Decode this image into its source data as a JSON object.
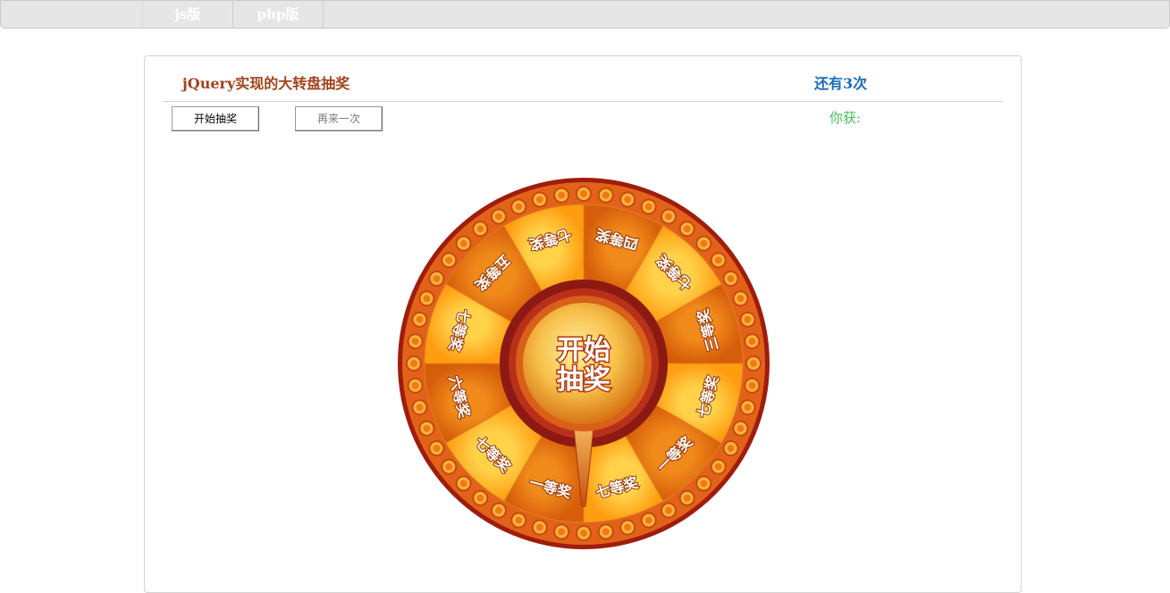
{
  "nav": {
    "tabs": [
      {
        "label": "js版"
      },
      {
        "label": "php版"
      }
    ]
  },
  "panel": {
    "title": "jQuery实现的大转盘抽奖",
    "remaining": "还有3次",
    "start_button": "开始抽奖",
    "again_button": "再来一次",
    "result_label": "你获:"
  },
  "wheel": {
    "center_text_line1": "开始",
    "center_text_line2": "抽奖",
    "prizes": [
      "四等奖",
      "七等奖",
      "三等奖",
      "七等奖",
      "一等奖",
      "七等奖",
      "一等奖",
      "七等奖",
      "六等奖",
      "七等奖",
      "五等奖",
      "七等奖"
    ],
    "colors": {
      "outer_ring": "#a0200e",
      "rim": "#e05a10",
      "segment_light": "#ffab1a",
      "segment_dark": "#e8740e",
      "hub_ring": "#8c1a12",
      "hub_button": "#f2a93b",
      "label_color": "#ffffff"
    }
  }
}
